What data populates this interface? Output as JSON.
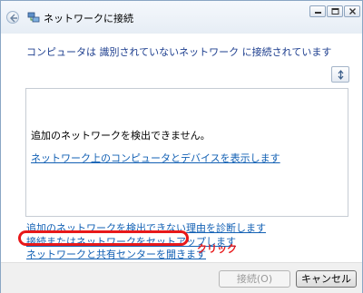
{
  "window": {
    "title": "ネットワークに接続"
  },
  "heading": "コンピュータは 識別されていないネットワーク に接続されています",
  "list": {
    "message": "追加のネットワークを検出できません。",
    "show_link": "ネットワーク上のコンピュータとデバイスを表示します"
  },
  "links": {
    "reason": "追加のネットワークを検出できない理由を診断します",
    "setup": "接続またはネットワークをセットアップします",
    "sharing": "ネットワークと共有センターを開きます"
  },
  "annotation": {
    "text": "クリック",
    "color": "#e8181a"
  },
  "buttons": {
    "connect": "接続(O)",
    "cancel": "キャンセル"
  },
  "icons": [
    "back-arrow-icon",
    "network-icon",
    "minimize-icon",
    "maximize-icon",
    "close-icon",
    "refresh-icon"
  ]
}
